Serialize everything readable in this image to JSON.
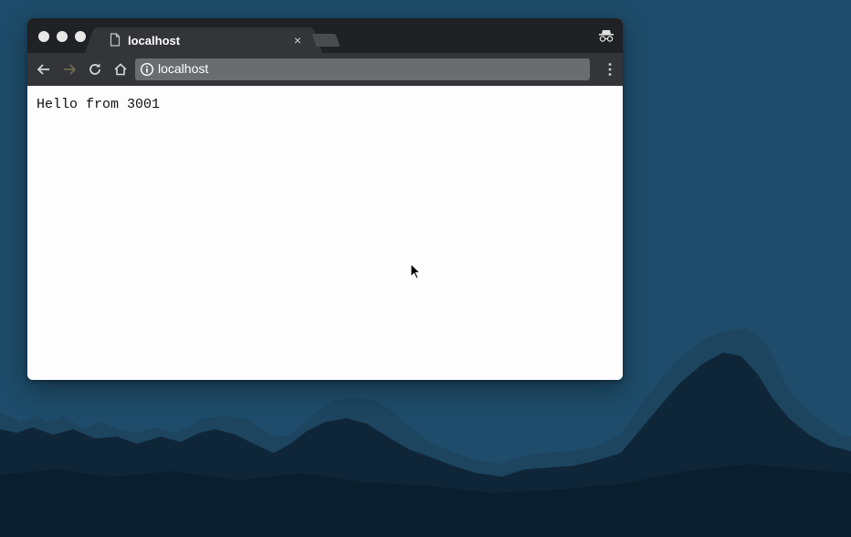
{
  "browser": {
    "tab": {
      "title": "localhost",
      "close_glyph": "×",
      "icon": "page-icon"
    },
    "address_bar": {
      "url": "localhost",
      "icon": "info-icon"
    },
    "toolbar_icons": [
      "back-arrow-icon",
      "forward-arrow-icon",
      "reload-icon",
      "home-icon",
      "menu-icon"
    ],
    "mode_icon": "incognito-icon"
  },
  "page": {
    "body_text": "Hello from 3001"
  },
  "colors": {
    "desktop_background": "#1e4c6a",
    "mountain_dark": "#0f2638",
    "mountain_mid": "#1d4560",
    "titlebar": "#202124",
    "toolbar": "#343538",
    "omnibox": "#6b6c6f",
    "page_background": "#fdfdfe"
  }
}
